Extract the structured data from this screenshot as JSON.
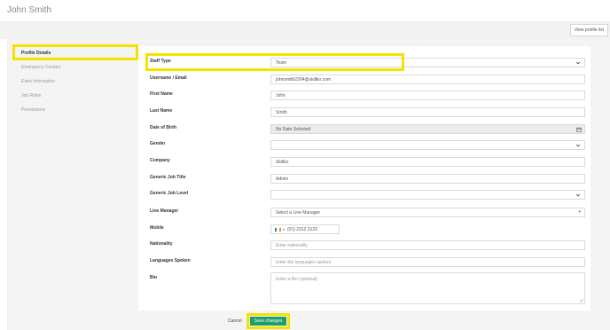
{
  "page": {
    "title": "John Smith"
  },
  "toolbar": {
    "view_profile_list": "View profile list"
  },
  "sidebar": {
    "items": [
      {
        "label": "Profile Details"
      },
      {
        "label": "Emergency Contact"
      },
      {
        "label": "Extra Information"
      },
      {
        "label": "Job Roles"
      },
      {
        "label": "Permissions"
      }
    ]
  },
  "form": {
    "staff_type": {
      "label": "Staff Type",
      "value": "Team"
    },
    "username": {
      "label": "Username / Email",
      "value": "johnsmith2304@skillko.com"
    },
    "first_name": {
      "label": "First Name",
      "value": "John"
    },
    "last_name": {
      "label": "Last Name",
      "value": "Smith"
    },
    "dob": {
      "label": "Date of Birth",
      "value": "No Date Selected"
    },
    "gender": {
      "label": "Gender",
      "value": ""
    },
    "company": {
      "label": "Company",
      "value": "Skillko"
    },
    "job_title": {
      "label": "Generic Job Title",
      "value": "Admin"
    },
    "job_level": {
      "label": "Generic Job Level",
      "value": ""
    },
    "line_manager": {
      "label": "Line Manager",
      "value": "Select a Line Manager"
    },
    "mobile": {
      "label": "Mobile",
      "value": "(01) 2312 3123"
    },
    "nationality": {
      "label": "Nationality",
      "placeholder": "Enter nationality"
    },
    "languages": {
      "label": "Languages Spoken",
      "placeholder": "Enter the languages spoken"
    },
    "bio": {
      "label": "Bio",
      "placeholder": "Enter a Bio (optional)"
    }
  },
  "actions": {
    "cancel": "Cancel",
    "save": "Save changes"
  },
  "colors": {
    "accent": "#1e9e6a",
    "highlight": "#f2e400",
    "flag": [
      "#169b62",
      "#ffffff",
      "#ff883e"
    ]
  }
}
